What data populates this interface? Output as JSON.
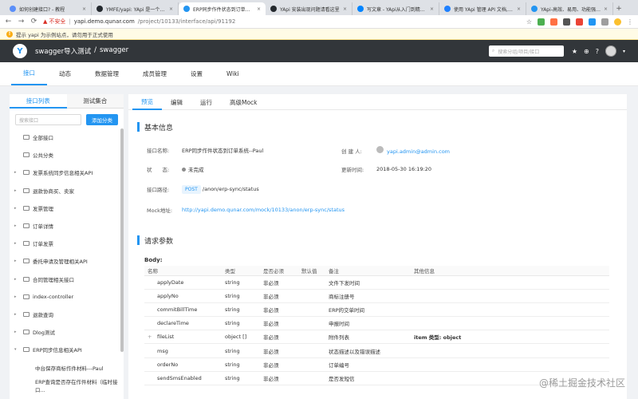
{
  "browser": {
    "tabs": [
      {
        "title": "如何创建接口? - 教程",
        "color": "#5b8ff9"
      },
      {
        "title": "YMFE/yapi: YApi 是一个可本地...",
        "color": "#24292e"
      },
      {
        "title": "ERP同步作件状态到订单系统...",
        "color": "#2395f1"
      },
      {
        "title": "YApi 安装出现问题请看这里",
        "color": "#24292e"
      },
      {
        "title": "写文章 - YApi从入门到精通...",
        "color": "#0084ff"
      },
      {
        "title": "使用 YApi 管理 API 文档,测...",
        "color": "#1e80ff"
      },
      {
        "title": "YApi-高效、易用、功能强大的",
        "color": "#2395f1"
      }
    ],
    "insecure": "不安全",
    "host": "yapi.demo.qunar.com",
    "path": "/project/10133/interface/api/91192"
  },
  "alert": "提示 yapi 为示例站点，请勿用于正式使用",
  "header": {
    "crumb_project": "swagger导入测试",
    "crumb_sep": "/",
    "crumb_sub": "swagger",
    "search_placeholder": "搜索分组/项目/接口"
  },
  "subnav": [
    "接口",
    "动态",
    "数据管理",
    "成员管理",
    "设置",
    "Wiki"
  ],
  "left": {
    "tabs": [
      "接口列表",
      "测试集合"
    ],
    "search_placeholder": "搜索接口",
    "add_label": "添加分类",
    "tree": [
      {
        "label": "全部接口",
        "caret": "",
        "sub": false
      },
      {
        "label": "公共分类",
        "caret": "",
        "sub": false
      },
      {
        "label": "发票系统同步信息相关API",
        "caret": "▸",
        "sub": false
      },
      {
        "label": "退款协商买、卖家",
        "caret": "▸",
        "sub": false
      },
      {
        "label": "发票管理",
        "caret": "▸",
        "sub": false
      },
      {
        "label": "订单详情",
        "caret": "▸",
        "sub": false
      },
      {
        "label": "订单发票",
        "caret": "▸",
        "sub": false
      },
      {
        "label": "委托申请及管理相关API",
        "caret": "▸",
        "sub": false
      },
      {
        "label": "合同管理相关接口",
        "caret": "▸",
        "sub": false
      },
      {
        "label": "index-controller",
        "caret": "▸",
        "sub": false
      },
      {
        "label": "退款查询",
        "caret": "▸",
        "sub": false
      },
      {
        "label": "Dlog测试",
        "caret": "▸",
        "sub": false
      },
      {
        "label": "ERP同步信息相关API",
        "caret": "▾",
        "sub": false
      },
      {
        "label": "中台保存商标作件材料---Paul",
        "caret": "",
        "sub": true
      },
      {
        "label": "ERP查询是否存在作件材料（临时接口...",
        "caret": "",
        "sub": true
      }
    ]
  },
  "right": {
    "tabs": [
      "预览",
      "编辑",
      "运行",
      "高级Mock"
    ],
    "basic_title": "基本信息",
    "info": {
      "name_label": "接口名称:",
      "name": "ERP同步作件状态到订单系统--Paul",
      "creator_label": "创 建 人:",
      "creator": "yapi.admin@admin.com",
      "status_label": "状　　态:",
      "status": "未完成",
      "updated_label": "更新时间:",
      "updated": "2018-05-30 16:19:20",
      "path_label": "接口路径:",
      "method": "POST",
      "path": "/anon/erp-sync/status",
      "mock_label": "Mock地址:",
      "mock": "http://yapi.demo.qunar.com/mock/10133/anon/erp-sync/status"
    },
    "req_title": "请求参数",
    "body_label": "Body:",
    "columns": [
      "名称",
      "类型",
      "是否必须",
      "默认值",
      "备注",
      "其他信息"
    ],
    "rows": [
      {
        "name": "applyDate",
        "type": "string",
        "req": "非必须",
        "def": "",
        "note": "文件下发时间",
        "other": "",
        "exp": ""
      },
      {
        "name": "applyNo",
        "type": "string",
        "req": "非必须",
        "def": "",
        "note": "商标注册号",
        "other": "",
        "exp": ""
      },
      {
        "name": "commitBillTime",
        "type": "string",
        "req": "非必须",
        "def": "",
        "note": "ERP的交单时间",
        "other": "",
        "exp": ""
      },
      {
        "name": "declareTime",
        "type": "string",
        "req": "非必须",
        "def": "",
        "note": "申报时间",
        "other": "",
        "exp": ""
      },
      {
        "name": "fileList",
        "type": "object []",
        "req": "非必须",
        "def": "",
        "note": "附件列表",
        "other": "item 类型: object",
        "exp": "+"
      },
      {
        "name": "msg",
        "type": "string",
        "req": "非必须",
        "def": "",
        "note": "状态描述以及错误描述",
        "other": "",
        "exp": ""
      },
      {
        "name": "orderNo",
        "type": "string",
        "req": "非必须",
        "def": "",
        "note": "订单编号",
        "other": "",
        "exp": ""
      },
      {
        "name": "sendSmsEnabled",
        "type": "string",
        "req": "非必须",
        "def": "",
        "note": "是否发短信",
        "other": "",
        "exp": ""
      }
    ]
  },
  "watermark": "@稀土掘金技术社区"
}
